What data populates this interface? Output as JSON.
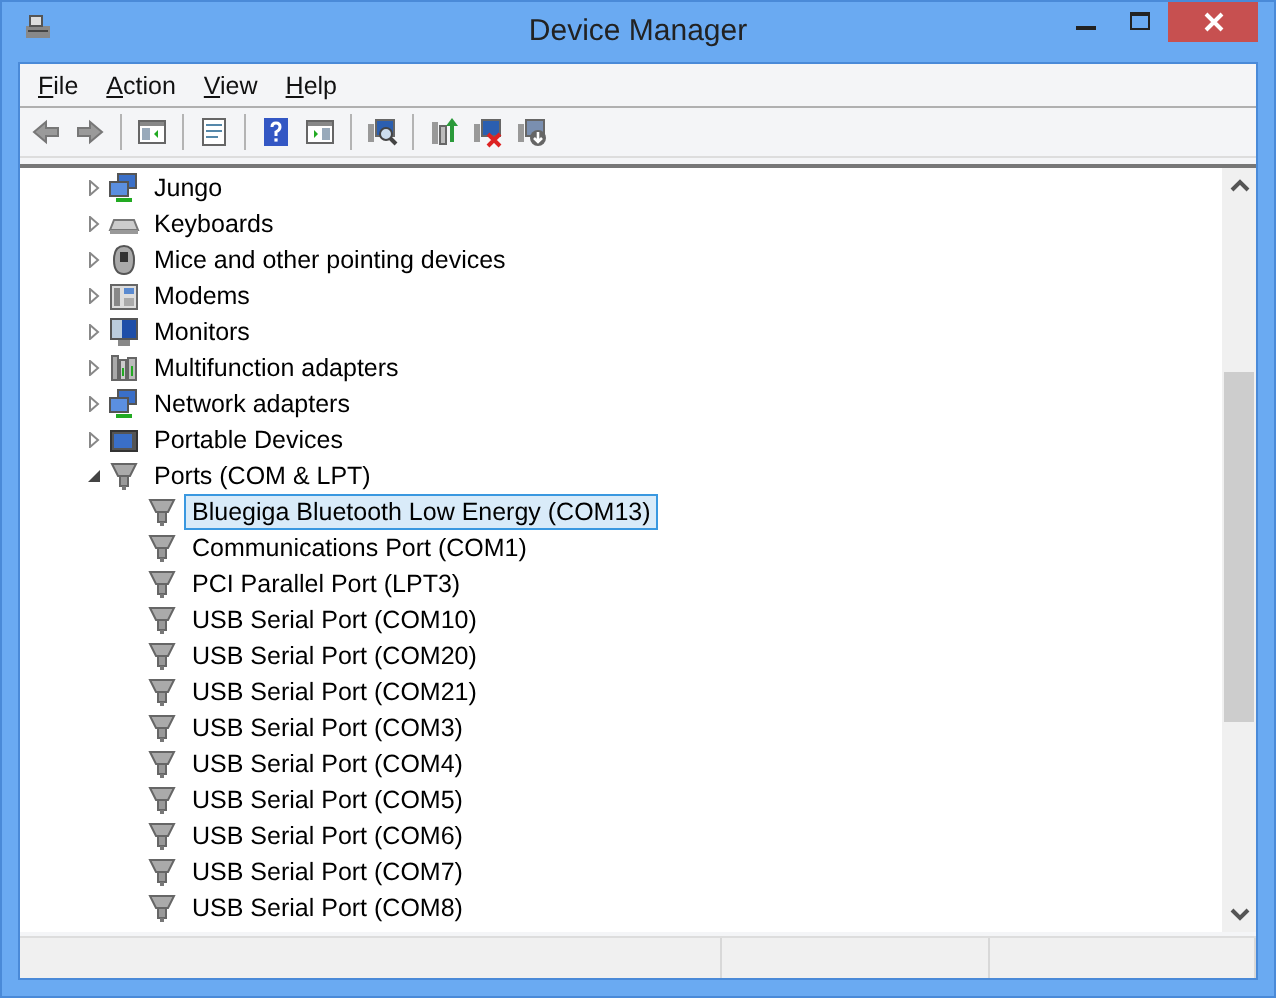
{
  "window": {
    "title": "Device Manager"
  },
  "menu": [
    {
      "label": "File"
    },
    {
      "label": "Action"
    },
    {
      "label": "View"
    },
    {
      "label": "Help"
    }
  ],
  "tree": [
    {
      "label": "Jungo",
      "kind": "network",
      "expanded": false,
      "selected": false
    },
    {
      "label": "Keyboards",
      "kind": "keyboard",
      "expanded": false,
      "selected": false
    },
    {
      "label": "Mice and other pointing devices",
      "kind": "mouse",
      "expanded": false,
      "selected": false
    },
    {
      "label": "Modems",
      "kind": "modem",
      "expanded": false,
      "selected": false
    },
    {
      "label": "Monitors",
      "kind": "monitor",
      "expanded": false,
      "selected": false
    },
    {
      "label": "Multifunction adapters",
      "kind": "multifunction",
      "expanded": false,
      "selected": false
    },
    {
      "label": "Network adapters",
      "kind": "network",
      "expanded": false,
      "selected": false
    },
    {
      "label": "Portable Devices",
      "kind": "portable",
      "expanded": false,
      "selected": false
    },
    {
      "label": "Ports (COM & LPT)",
      "kind": "port",
      "expanded": true,
      "selected": false,
      "children": [
        {
          "label": "Bluegiga Bluetooth Low Energy (COM13)",
          "kind": "port",
          "selected": true
        },
        {
          "label": "Communications Port (COM1)",
          "kind": "port",
          "selected": false
        },
        {
          "label": "PCI Parallel Port (LPT3)",
          "kind": "port",
          "selected": false
        },
        {
          "label": "USB Serial Port (COM10)",
          "kind": "port",
          "selected": false
        },
        {
          "label": "USB Serial Port (COM20)",
          "kind": "port",
          "selected": false
        },
        {
          "label": "USB Serial Port (COM21)",
          "kind": "port",
          "selected": false
        },
        {
          "label": "USB Serial Port (COM3)",
          "kind": "port",
          "selected": false
        },
        {
          "label": "USB Serial Port (COM4)",
          "kind": "port",
          "selected": false
        },
        {
          "label": "USB Serial Port (COM5)",
          "kind": "port",
          "selected": false
        },
        {
          "label": "USB Serial Port (COM6)",
          "kind": "port",
          "selected": false
        },
        {
          "label": "USB Serial Port (COM7)",
          "kind": "port",
          "selected": false
        },
        {
          "label": "USB Serial Port (COM8)",
          "kind": "port",
          "selected": false
        }
      ]
    }
  ]
}
